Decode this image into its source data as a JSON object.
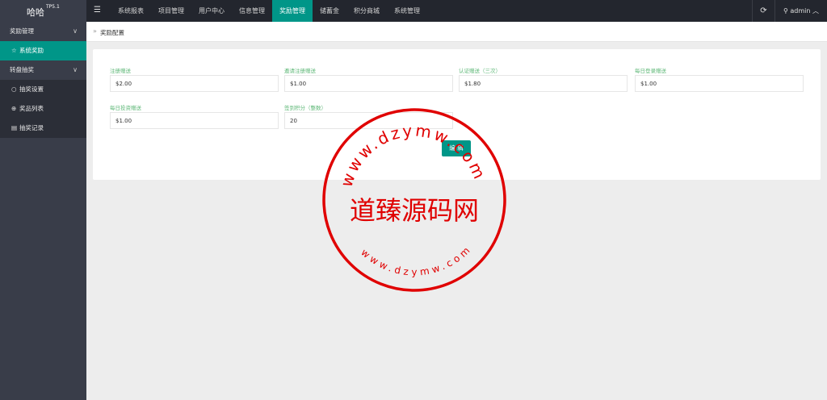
{
  "logo": {
    "name": "哈哈",
    "version": "TP5.1"
  },
  "menu_toggle_icon": "hamburger-icon",
  "nav": [
    {
      "label": "系统报表",
      "active": false
    },
    {
      "label": "项目管理",
      "active": false
    },
    {
      "label": "用户中心",
      "active": false
    },
    {
      "label": "信息管理",
      "active": false
    },
    {
      "label": "奖励管理",
      "active": true
    },
    {
      "label": "储蓄金",
      "active": false
    },
    {
      "label": "积分商城",
      "active": false
    },
    {
      "label": "系统管理",
      "active": false
    }
  ],
  "user": {
    "name": "admin",
    "refresh_icon": "refresh-icon"
  },
  "sidebar": {
    "group1": {
      "label": "奖励管理"
    },
    "item_system_reward": {
      "label": "系统奖励",
      "icon": "star-icon"
    },
    "group2": {
      "label": "转盘抽奖"
    },
    "item_draw_settings": {
      "label": "抽奖设置",
      "icon": "circle-icon"
    },
    "item_prize_list": {
      "label": "奖品列表",
      "icon": "plus-circle-icon"
    },
    "item_draw_records": {
      "label": "抽奖记录",
      "icon": "list-icon"
    }
  },
  "breadcrumb": {
    "text": "奖励配置"
  },
  "form": {
    "register_bonus": {
      "label": "注册赠送",
      "value": "$2.00"
    },
    "invite_bonus": {
      "label": "邀请注册赠送",
      "value": "$1.00"
    },
    "verify_bonus": {
      "label": "认证赠送（三次）",
      "value": "$1.80"
    },
    "daily_login_bonus": {
      "label": "每日登录赠送",
      "value": "$1.00"
    },
    "daily_invest_bonus": {
      "label": "每日投资赠送",
      "value": "$1.00"
    },
    "checkin_points": {
      "label": "签到积分（整数）",
      "value": "20"
    },
    "edit_button": "编 辑"
  },
  "watermark": {
    "text": "道臻源码网",
    "url_top": "www.dzymw.com",
    "url_bottom": "www.dzymw.com",
    "color": "#e00000"
  }
}
